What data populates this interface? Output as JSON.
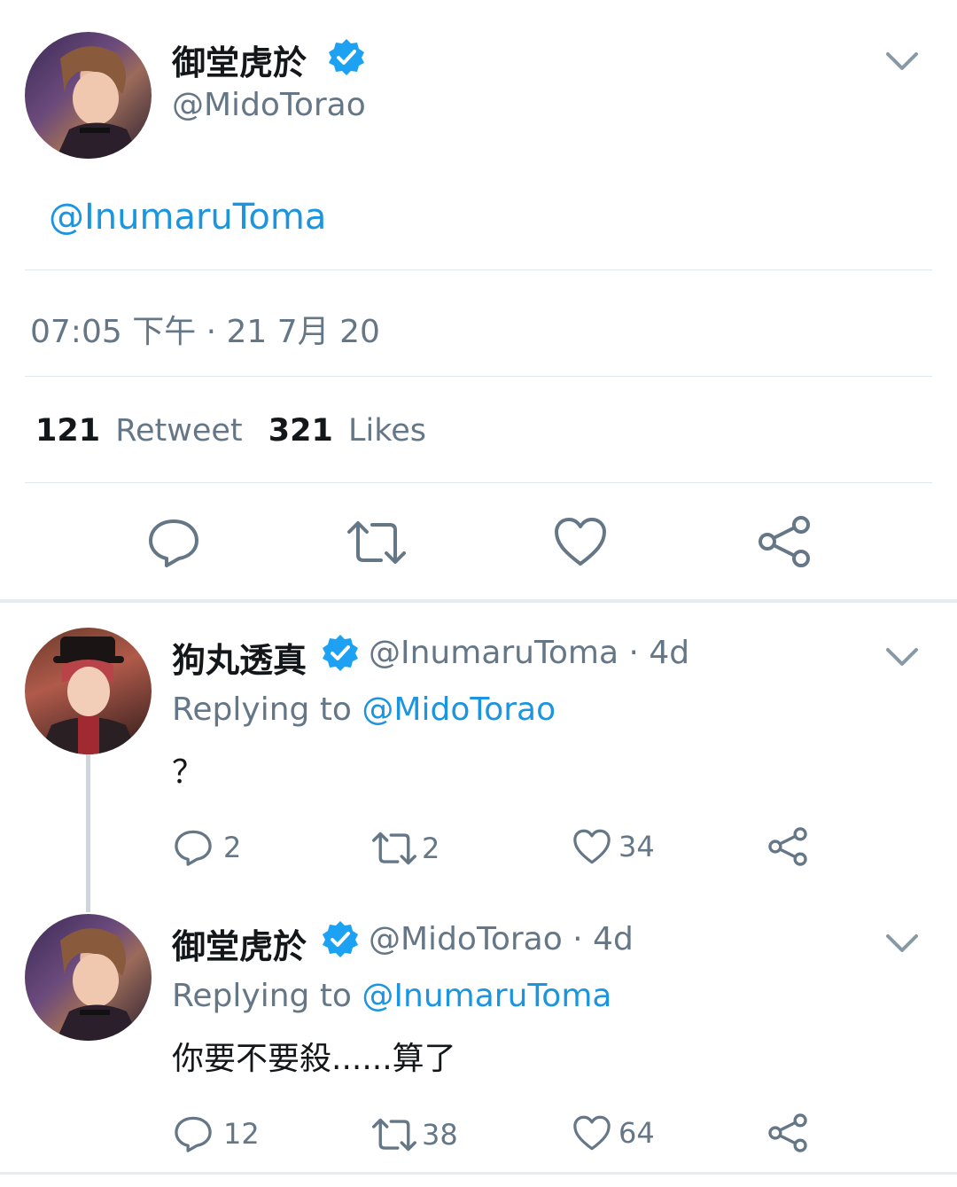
{
  "main_tweet": {
    "author_name": "御堂虎於",
    "author_handle": "@MidoTorao",
    "text": "@InumaruToma",
    "timestamp": "07:05 下午 · 21 7月 20",
    "retweet_count": "121",
    "retweet_label": "Retweet",
    "likes_count": "321",
    "likes_label": "Likes"
  },
  "replies": [
    {
      "author_name": "狗丸透真",
      "author_handle": "@InumaruToma · 4d",
      "replying_prefix": "Replying to",
      "replying_to": "@MidoTorao",
      "text": "？",
      "reply_count": "2",
      "retweet_count": "2",
      "like_count": "34"
    },
    {
      "author_name": "御堂虎於",
      "author_handle": "@MidoTorao · 4d",
      "replying_prefix": "Replying to",
      "replying_to": "@InumaruToma",
      "text": "你要不要殺......算了",
      "reply_count": "12",
      "retweet_count": "38",
      "like_count": "64"
    }
  ],
  "colors": {
    "link": "#1b95e0",
    "verified": "#1da1f2",
    "secondary_text": "#657786",
    "divider": "#e1e8ed"
  }
}
